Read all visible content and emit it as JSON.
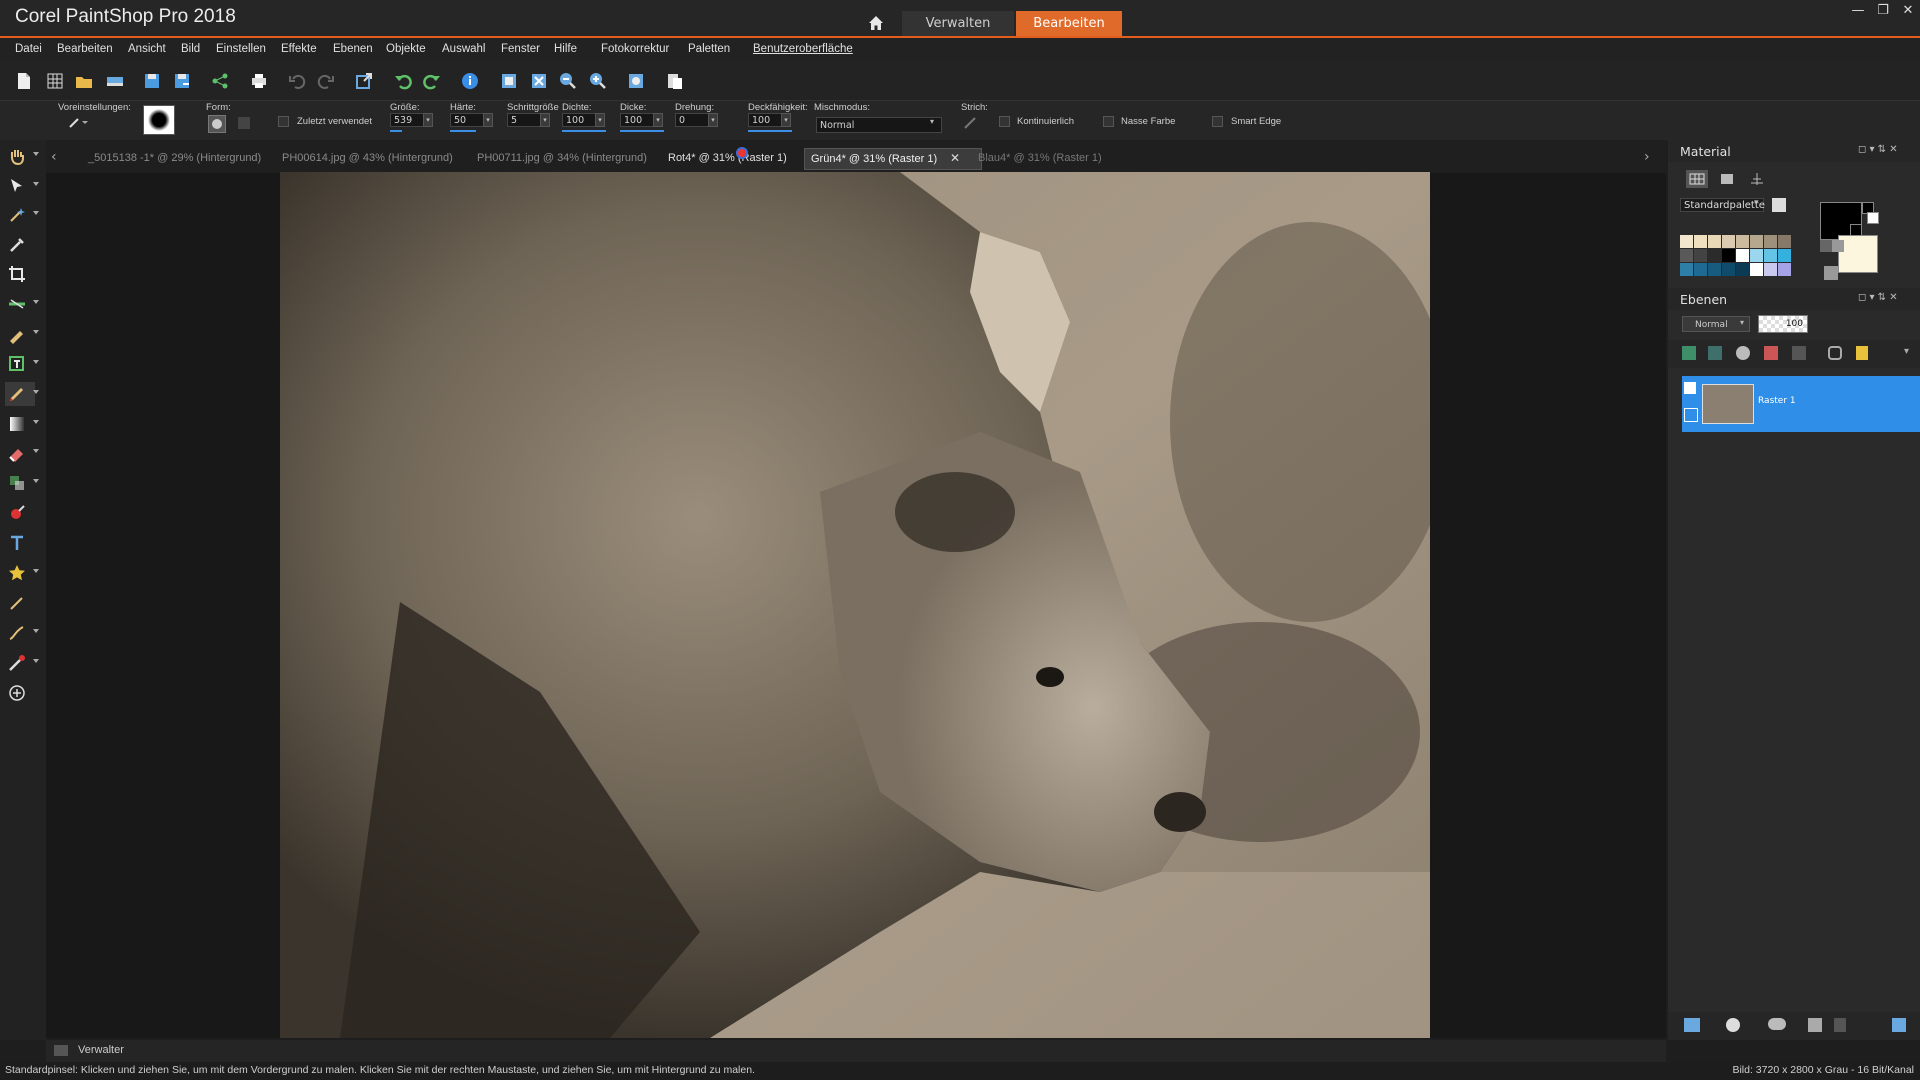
{
  "app": {
    "title": "Corel PaintShop Pro 2018"
  },
  "workspace_tabs": {
    "manage": "Verwalten",
    "edit": "Bearbeiten"
  },
  "menu": [
    "Datei",
    "Bearbeiten",
    "Ansicht",
    "Bild",
    "Einstellen",
    "Effekte",
    "Ebenen",
    "Objekte",
    "Auswahl",
    "Fenster",
    "Hilfe",
    "Fotokorrektur",
    "Paletten",
    "Benutzeroberfläche"
  ],
  "options": {
    "presets_label": "Voreinstellungen:",
    "shape_label": "Form:",
    "recent_label": "Zuletzt verwendet",
    "size_label": "Größe:",
    "size": "539",
    "hardness_label": "Härte:",
    "hardness": "50",
    "step_label": "Schrittgröße",
    "step": "5",
    "density_label": "Dichte:",
    "density": "100",
    "thickness_label": "Dicke:",
    "thickness": "100",
    "rotation_label": "Drehung:",
    "rotation": "0",
    "opacity_label": "Deckfähigkeit:",
    "opacity": "100",
    "blend_label": "Mischmodus:",
    "blend": "Normal",
    "stroke_label": "Strich:",
    "continuous": "Kontinuierlich",
    "wet": "Nasse Farbe",
    "smart_edge": "Smart Edge"
  },
  "doc_tabs": [
    {
      "label": "_5015138 -1* @  29% (Hintergrund)",
      "active": false
    },
    {
      "label": "PH00614.jpg @  43% (Hintergrund)",
      "active": false
    },
    {
      "label": "PH00711.jpg @  34% (Hintergrund)",
      "active": false
    },
    {
      "label": "Rot4* @  31% (Raster 1)",
      "active": false
    },
    {
      "label": "Grün4* @  31% (Raster 1)",
      "active": true
    },
    {
      "label": "Blau4* @  31% (Raster 1)",
      "active": false
    }
  ],
  "material": {
    "title": "Material",
    "palette": "Standardpalette",
    "swatches": [
      "#f2e6cf",
      "#efe0c0",
      "#e9d8b8",
      "#dccbb0",
      "#cdbba0",
      "#b6a88e",
      "#9e917c",
      "#86796a",
      "#595959",
      "#434343",
      "#2b2b2b",
      "#000000",
      "#ffffff",
      "#9ad7ee",
      "#63c4e6",
      "#34b1de",
      "#2e7fa8",
      "#1f6a92",
      "#175c7e",
      "#0f4b6a",
      "#0b3a55",
      "#ffffff",
      "#c9c9f0",
      "#a3a3e6"
    ],
    "fg": "#000000",
    "bg": "#fbf6dd"
  },
  "layers": {
    "title": "Ebenen",
    "blend": "Normal",
    "opacity": "100",
    "items": [
      {
        "name": "Raster 1",
        "selected": true
      }
    ]
  },
  "verwalter": "Verwalter",
  "status": {
    "left": "Standardpinsel: Klicken und ziehen Sie, um mit dem Vordergrund zu malen. Klicken Sie mit der rechten Maustaste, und ziehen Sie, um mit Hintergrund zu malen.",
    "right": "Bild:  3720 x 2800 x Grau - 16 Bit/Kanal"
  },
  "colors": {
    "accent": "#e06a2a",
    "selection": "#2f8fe8"
  }
}
